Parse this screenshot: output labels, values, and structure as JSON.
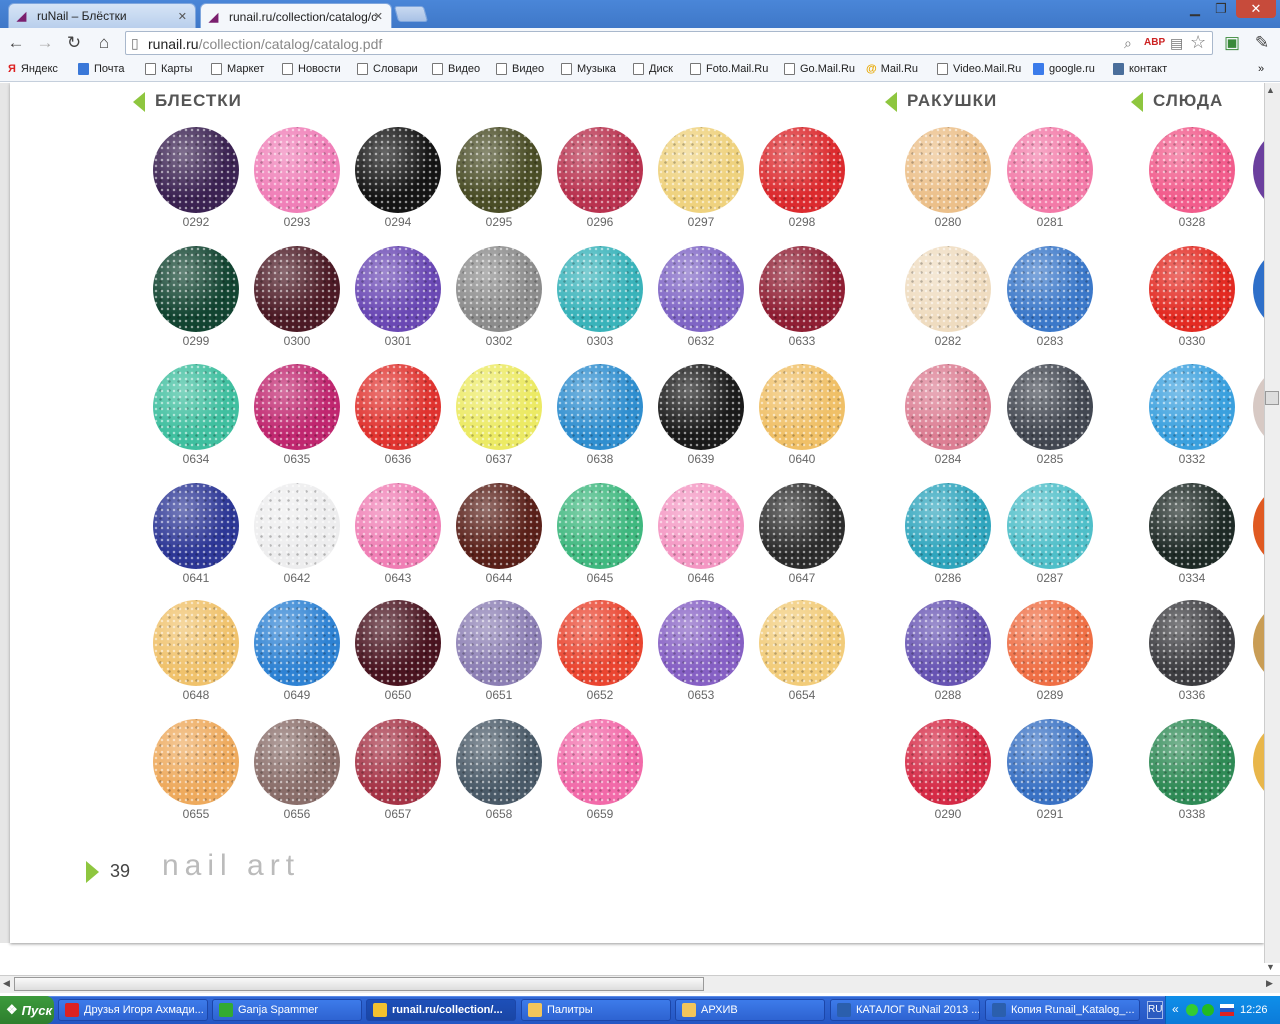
{
  "browser": {
    "tabs": [
      {
        "title": "ruNail – Блёстки",
        "active": false
      },
      {
        "title": "runail.ru/collection/catalog/c",
        "active": true
      }
    ],
    "url_host": "runail.ru",
    "url_path": "/collection/catalog/catalog.pdf",
    "bookmarks": [
      "Яндекс",
      "Почта",
      "Карты",
      "Маркет",
      "Новости",
      "Словари",
      "Видео",
      "Видео",
      "Музыка",
      "Диск",
      "Foto.Mail.Ru",
      "Go.Mail.Ru",
      "Mail.Ru",
      "Video.Mail.Ru",
      "google.ru",
      "контакт"
    ]
  },
  "page": {
    "number": "39",
    "footer_title": "nail art",
    "sections": [
      {
        "title": "БЛЕСТКИ",
        "items": [
          {
            "code": "0292",
            "color": "#3b2252"
          },
          {
            "code": "0293",
            "color": "#f07fb8"
          },
          {
            "code": "0294",
            "color": "#141414"
          },
          {
            "code": "0295",
            "color": "#4a4d26"
          },
          {
            "code": "0296",
            "color": "#b9324f"
          },
          {
            "code": "0297",
            "color": "#efd27e"
          },
          {
            "code": "0298",
            "color": "#dc2a2e"
          },
          {
            "code": "0299",
            "color": "#124431"
          },
          {
            "code": "0300",
            "color": "#4c1a25"
          },
          {
            "code": "0301",
            "color": "#6a48b4"
          },
          {
            "code": "0302",
            "color": "#8c8c8c"
          },
          {
            "code": "0303",
            "color": "#39b3ba"
          },
          {
            "code": "0632",
            "color": "#7f65c5"
          },
          {
            "code": "0633",
            "color": "#8f1e33"
          },
          {
            "code": "0634",
            "color": "#3fbf9f"
          },
          {
            "code": "0635",
            "color": "#c0266f"
          },
          {
            "code": "0636",
            "color": "#e0332f"
          },
          {
            "code": "0637",
            "color": "#ecea64"
          },
          {
            "code": "0638",
            "color": "#2f8ecf"
          },
          {
            "code": "0639",
            "color": "#1a1a1a"
          },
          {
            "code": "0640",
            "color": "#f0c067"
          },
          {
            "code": "0641",
            "color": "#2d3796"
          },
          {
            "code": "0642",
            "color": "#ededee"
          },
          {
            "code": "0643",
            "color": "#f07fb5"
          },
          {
            "code": "0644",
            "color": "#5a2019"
          },
          {
            "code": "0645",
            "color": "#3fb87f"
          },
          {
            "code": "0646",
            "color": "#f497c3"
          },
          {
            "code": "0647",
            "color": "#2c2c2c"
          },
          {
            "code": "0648",
            "color": "#f0c26c"
          },
          {
            "code": "0649",
            "color": "#2e82d3"
          },
          {
            "code": "0650",
            "color": "#4a1420"
          },
          {
            "code": "0651",
            "color": "#8c7fb4"
          },
          {
            "code": "0652",
            "color": "#ea4530"
          },
          {
            "code": "0653",
            "color": "#8660c4"
          },
          {
            "code": "0654",
            "color": "#f2cc7a"
          },
          {
            "code": "0655",
            "color": "#eeaa5d"
          },
          {
            "code": "0656",
            "color": "#8a6e6a"
          },
          {
            "code": "0657",
            "color": "#a53346"
          },
          {
            "code": "0658",
            "color": "#4a5a68"
          },
          {
            "code": "0659",
            "color": "#f26aa9"
          }
        ]
      },
      {
        "title": "РАКУШКИ",
        "items": [
          {
            "code": "0280",
            "color": "#ecc08a"
          },
          {
            "code": "0281",
            "color": "#f37aa8"
          },
          {
            "code": "0282",
            "color": "#efdcc0"
          },
          {
            "code": "0283",
            "color": "#3b78c9"
          },
          {
            "code": "0284",
            "color": "#dc7e93"
          },
          {
            "code": "0285",
            "color": "#424751"
          },
          {
            "code": "0286",
            "color": "#2fa5bd"
          },
          {
            "code": "0287",
            "color": "#4fbfc9"
          },
          {
            "code": "0288",
            "color": "#6754b3"
          },
          {
            "code": "0289",
            "color": "#ef6f45"
          },
          {
            "code": "0290",
            "color": "#d52a46"
          },
          {
            "code": "0291",
            "color": "#3a72c4"
          }
        ]
      },
      {
        "title": "СЛЮДА",
        "items": [
          {
            "code": "0328",
            "color": "#f25c8c"
          },
          {
            "code": "0330",
            "color": "#e32a22"
          },
          {
            "code": "0332",
            "color": "#3aa0de"
          },
          {
            "code": "0334",
            "color": "#1e2a26"
          },
          {
            "code": "0336",
            "color": "#3c3c40"
          },
          {
            "code": "0338",
            "color": "#2e8a55"
          }
        ]
      }
    ]
  },
  "taskbar": {
    "start": "Пуск",
    "tasks": [
      {
        "label": "Друзья Игоря Ахмади...",
        "color": "#d22"
      },
      {
        "label": "Ganja Spammer",
        "color": "#3a3"
      },
      {
        "label": "runail.ru/collection/...",
        "color": "#f2c12e",
        "active": true
      },
      {
        "label": "Палитры",
        "color": "#f3c55b"
      },
      {
        "label": "АРХИВ",
        "color": "#f3c55b"
      },
      {
        "label": "КАТАЛОГ RuNail 2013 ...",
        "color": "#2b5fad"
      },
      {
        "label": "Копия Runail_Katalog_...",
        "color": "#2b5fad"
      }
    ],
    "lang": "RU",
    "clock": "12:26"
  }
}
